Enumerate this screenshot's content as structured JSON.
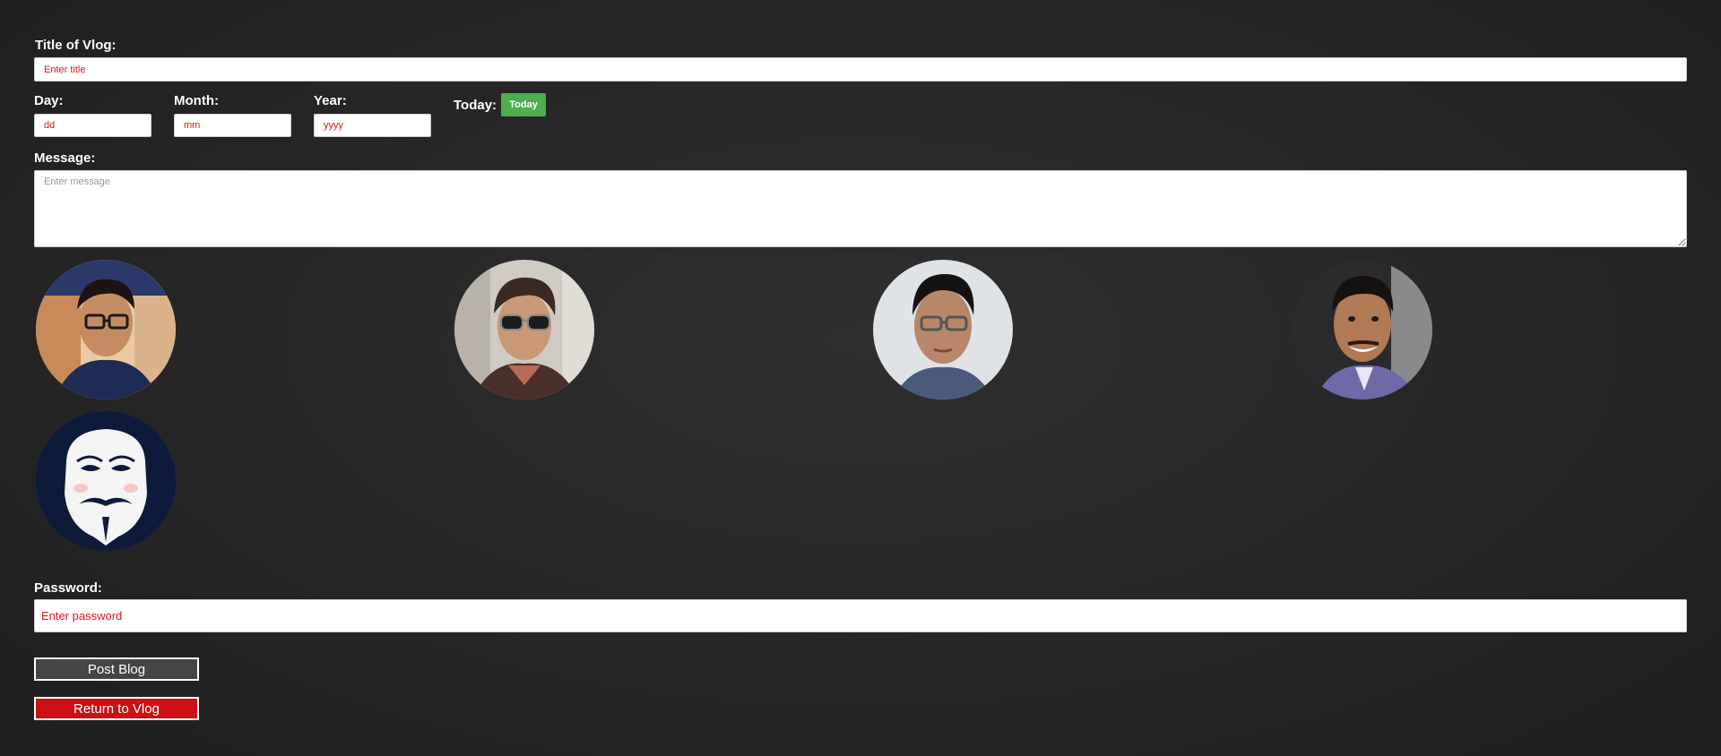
{
  "form": {
    "title_label": "Title of Vlog:",
    "title_placeholder": "Enter title",
    "day_label": "Day:",
    "day_placeholder": "dd",
    "month_label": "Month:",
    "month_placeholder": "mm",
    "year_label": "Year:",
    "year_placeholder": "yyyy",
    "today_label": "Today:",
    "today_button": "Today",
    "message_label": "Message:",
    "message_placeholder": "Enter message",
    "password_label": "Password:",
    "password_placeholder": "Enter password"
  },
  "avatars": [
    {
      "name": "avatar-1",
      "description_icon": "person-photo-glasses-icon"
    },
    {
      "name": "avatar-2",
      "description_icon": "person-photo-sunglasses-icon"
    },
    {
      "name": "avatar-3",
      "description_icon": "person-photo-glasses-icon"
    },
    {
      "name": "avatar-4",
      "description_icon": "person-photo-smiling-icon"
    },
    {
      "name": "avatar-5",
      "description_icon": "guy-fawkes-mask-icon"
    }
  ],
  "buttons": {
    "post": "Post Blog",
    "return": "Return to Vlog"
  },
  "colors": {
    "placeholder_red": "#e0141e",
    "today_green": "#4caf50",
    "return_red": "#cc1013",
    "post_gray": "#454545"
  }
}
